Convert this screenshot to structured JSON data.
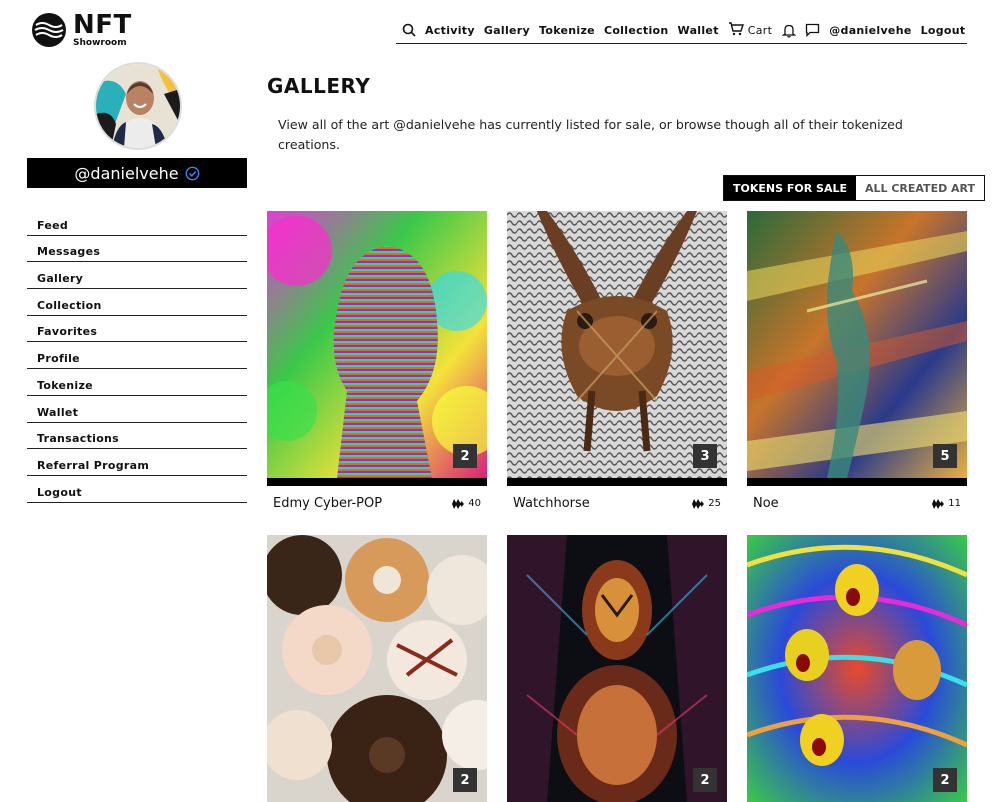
{
  "brand": {
    "name": "NFT",
    "sub": "Showroom"
  },
  "nav": {
    "items": [
      "Activity",
      "Gallery",
      "Tokenize",
      "Collection",
      "Wallet"
    ],
    "cart_label": "Cart",
    "user": "@danielvehe",
    "logout": "Logout"
  },
  "sidebar": {
    "username": "@danielvehe",
    "items": [
      "Feed",
      "Messages",
      "Gallery",
      "Collection",
      "Favorites",
      "Profile",
      "Tokenize",
      "Wallet",
      "Transactions",
      "Referral Program",
      "Logout"
    ]
  },
  "main": {
    "title": "GALLERY",
    "description": "View all of the art @danielvehe has currently listed for sale, or browse though all of their tokenized creations.",
    "tabs": {
      "active": "TOKENS FOR SALE",
      "inactive": "ALL CREATED ART"
    },
    "cards": [
      {
        "name": "Edmy Cyber-POP",
        "price": "40",
        "count": "2"
      },
      {
        "name": "Watchhorse",
        "price": "25",
        "count": "3"
      },
      {
        "name": "Noe",
        "price": "11",
        "count": "5"
      },
      {
        "name": "",
        "price": "",
        "count": "2"
      },
      {
        "name": "",
        "price": "",
        "count": "2"
      },
      {
        "name": "",
        "price": "",
        "count": "2"
      }
    ]
  },
  "colors": {
    "accent": "#000000",
    "verified": "#3b82f6"
  }
}
